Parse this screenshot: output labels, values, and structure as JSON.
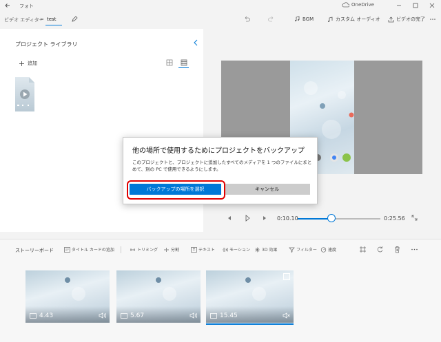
{
  "window": {
    "app_name": "フォト",
    "onedrive_label": "OneDrive"
  },
  "toolbar": {
    "breadcrumb_root": "ビデオ エディター",
    "breadcrumb_sep": ">",
    "project_name": "test",
    "bgm_label": "BGM",
    "custom_audio_label": "カスタム オーディオ",
    "finish_label": "ビデオの完了"
  },
  "library": {
    "title": "プロジェクト ライブラリ",
    "add_label": "追加"
  },
  "playback": {
    "current_time": "0:10.10",
    "total_time": "0:25.56",
    "progress": 0.41
  },
  "storyboard": {
    "title": "ストーリーボード",
    "tools": [
      "タイトル カードの追加",
      "トリミング",
      "分割",
      "テキスト",
      "モーション",
      "3D 効果",
      "フィルター",
      "速度"
    ],
    "clips": [
      {
        "duration": "4.43",
        "volume_icon": "volume-icon"
      },
      {
        "duration": "5.67",
        "volume_icon": "volume-icon"
      },
      {
        "duration": "15.45",
        "volume_icon": "mute-icon"
      }
    ]
  },
  "dialog": {
    "title": "他の場所で使用するためにプロジェクトをバックアップ",
    "body": "このプロジェクトと、プロジェクトに追加したすべてのメディアを 1 つのファイルにまとめて、別の PC で使用できるようにします。",
    "primary_label": "バックアップの場所を選択",
    "secondary_label": "キャンセル"
  },
  "colors": {
    "accent": "#0078d7",
    "highlight": "#e00000"
  }
}
